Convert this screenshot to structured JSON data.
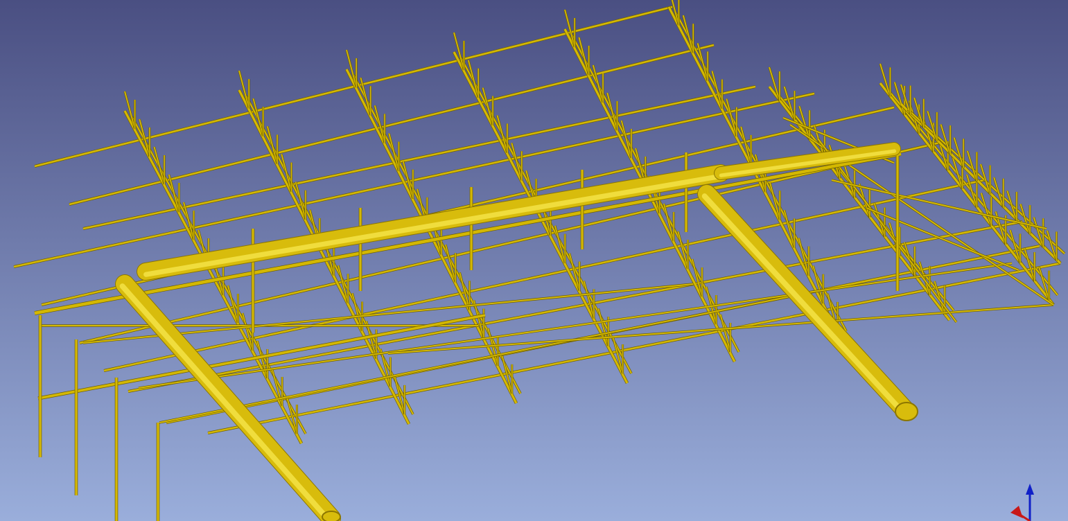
{
  "viewport": {
    "background_top": "#4a4f82",
    "background_bottom": "#9aaedb"
  },
  "structure": {
    "member_color": "#d4b800",
    "member_dark": "#6e5f00",
    "member_light": "#f2de30",
    "pipe_color": "#d8bc0c",
    "pipe_highlight": "#f6e64a",
    "pipe_shadow": "#8c7600",
    "trusses": 9,
    "rafters_per_truss": 10
  },
  "axis_triad": {
    "z_color": "#1020c8",
    "x_color": "#c81818"
  }
}
